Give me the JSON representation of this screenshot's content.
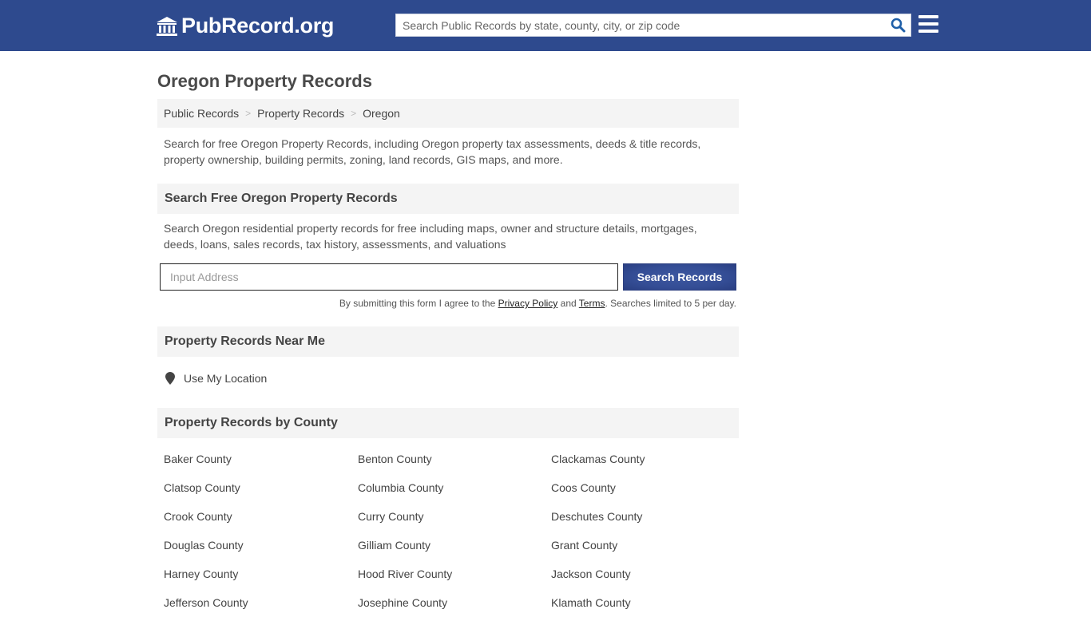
{
  "header": {
    "logo_text": "PubRecord.org",
    "search_placeholder": "Search Public Records by state, county, city, or zip code",
    "brand_color": "#2e4a8e",
    "search_icon": "magnifier-icon",
    "menu_icon": "hamburger-icon"
  },
  "page": {
    "title": "Oregon Property Records",
    "breadcrumb": [
      "Public Records",
      "Property Records",
      "Oregon"
    ],
    "breadcrumb_separator": ">",
    "intro": "Search for free Oregon Property Records, including Oregon property tax assessments, deeds & title records, property ownership, building permits, zoning, land records, GIS maps, and more."
  },
  "search_section": {
    "heading": "Search Free Oregon Property Records",
    "description": "Search Oregon residential property records for free including maps, owner and structure details, mortgages, deeds, loans, sales records, tax history, assessments, and valuations",
    "address_placeholder": "Input Address",
    "submit_label": "Search Records",
    "disclaimer_prefix": "By submitting this form I agree to the ",
    "privacy_link": "Privacy Policy",
    "disclaimer_and": " and ",
    "terms_link": "Terms",
    "disclaimer_suffix": ". Searches limited to 5 per day."
  },
  "near_me": {
    "heading": "Property Records Near Me",
    "location_label": "Use My Location"
  },
  "by_county": {
    "heading": "Property Records by County",
    "counties": [
      "Baker County",
      "Benton County",
      "Clackamas County",
      "Clatsop County",
      "Columbia County",
      "Coos County",
      "Crook County",
      "Curry County",
      "Deschutes County",
      "Douglas County",
      "Gilliam County",
      "Grant County",
      "Harney County",
      "Hood River County",
      "Jackson County",
      "Jefferson County",
      "Josephine County",
      "Klamath County"
    ]
  }
}
